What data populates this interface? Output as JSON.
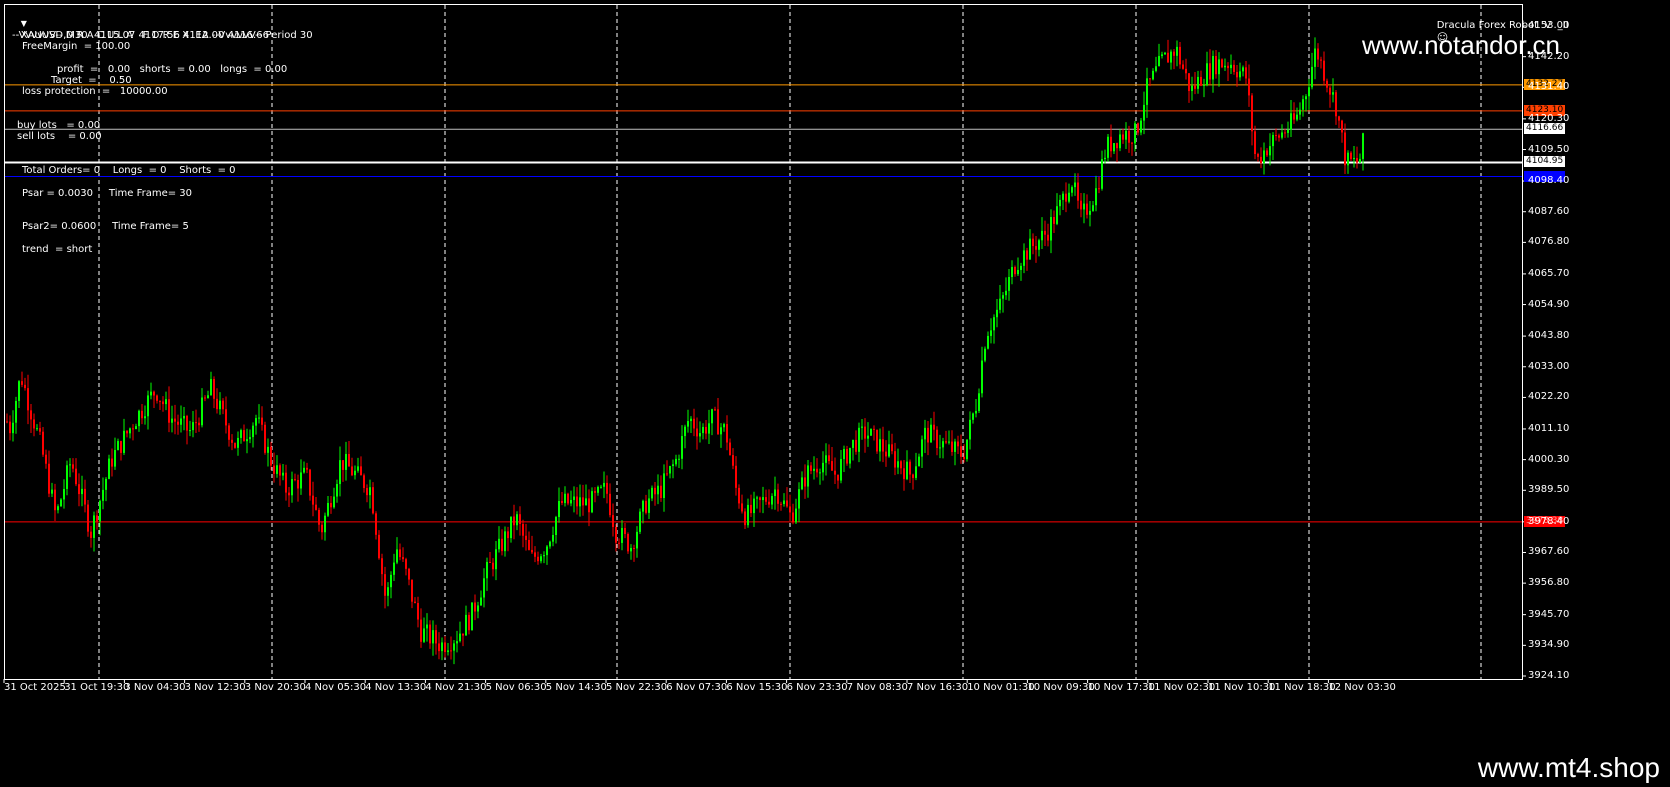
{
  "header": {
    "symbol_info": "XAUUSD,M30  4115.07 4117.56 4112.00 4116.66",
    "robot_label": "Dracula Forex Robot  V  _II"
  },
  "ea_panel": {
    "title": "--VvvvvV-- D R A C U L A   F O R E X  EA --VvvvvV-- Period 30",
    "free_margin": "FreeMargin  = 100.00",
    "profit_line": "profit  =   0.00   shorts  = 0.00   longs  = 0.00",
    "target_line": "Target  =    0.50",
    "loss_protection": "loss protection  =   10000.00",
    "buy_lots": "buy lots   = 0.00",
    "sell_lots": "sell lots    = 0.00",
    "total_orders": "Total Orders= 0    Longs  = 0    Shorts  = 0",
    "psar": "Psar = 0.0030     Time Frame= 30",
    "psar2": "Psar2= 0.0600     Time Frame= 5",
    "trend": "trend  = short"
  },
  "watermarks": {
    "top": "www.notandor.cn",
    "bottom": "www.mt4.shop"
  },
  "price_axis": {
    "ticks": [
      "4153.00",
      "4142.20",
      "4131.40",
      "4120.30",
      "4109.50",
      "4098.40",
      "4087.60",
      "4076.80",
      "4065.70",
      "4054.90",
      "4043.80",
      "4033.00",
      "4022.20",
      "4011.10",
      "4000.30",
      "3989.50",
      "3978.40",
      "3967.60",
      "3956.80",
      "3945.70",
      "3934.90",
      "3924.10"
    ],
    "tags": [
      {
        "label": "4132.27",
        "bg": "#ff9900",
        "fg": "#000000"
      },
      {
        "label": "4123.10",
        "bg": "#ff4000",
        "fg": "#000000"
      },
      {
        "label": "4116.66",
        "bg": "#ffffff",
        "fg": "#000000"
      },
      {
        "label": "4104.95",
        "bg": "#ffffff",
        "fg": "#000000"
      },
      {
        "label": "4100.00",
        "bg": "#0000ff",
        "fg": "#0000ff"
      },
      {
        "label": "3978.38",
        "bg": "#ff0000",
        "fg": "#ff9999"
      }
    ]
  },
  "time_axis": {
    "labels": [
      "31 Oct 2025",
      "31 Oct 19:30",
      "3 Nov 04:30",
      "3 Nov 12:30",
      "3 Nov 20:30",
      "4 Nov 05:30",
      "4 Nov 13:30",
      "4 Nov 21:30",
      "5 Nov 06:30",
      "5 Nov 14:30",
      "5 Nov 22:30",
      "6 Nov 07:30",
      "6 Nov 15:30",
      "6 Nov 23:30",
      "7 Nov 08:30",
      "7 Nov 16:30",
      "10 Nov 01:30",
      "10 Nov 09:30",
      "10 Nov 17:30",
      "11 Nov 02:30",
      "11 Nov 10:30",
      "11 Nov 18:30",
      "12 Nov 03:30"
    ]
  },
  "levels": {
    "orange": 4132.27,
    "red_orange": 4123.1,
    "gray": 4116.66,
    "white": 4104.95,
    "blue": 4100.0,
    "red": 3978.38
  },
  "colors": {
    "bull": "#00ff00",
    "bear": "#ff0000",
    "orange": "#ff9900",
    "red_orange": "#ff4000",
    "gray": "#c0c0c0",
    "white": "#ffffff",
    "blue": "#0000ff",
    "red": "#ff0000"
  },
  "chart_data": {
    "type": "candlestick",
    "symbol": "XAUUSD",
    "timeframe": "M30",
    "ylim": [
      3924.1,
      4153.0
    ],
    "anchors": [
      [
        0,
        4025
      ],
      [
        8,
        4010
      ],
      [
        20,
        4030
      ],
      [
        40,
        4005
      ],
      [
        55,
        3980
      ],
      [
        70,
        4000
      ],
      [
        90,
        3975
      ],
      [
        110,
        4000
      ],
      [
        135,
        4015
      ],
      [
        155,
        4025
      ],
      [
        170,
        4015
      ],
      [
        190,
        4010
      ],
      [
        210,
        4025
      ],
      [
        235,
        4005
      ],
      [
        255,
        4015
      ],
      [
        270,
        4000
      ],
      [
        285,
        3990
      ],
      [
        305,
        3995
      ],
      [
        320,
        3975
      ],
      [
        340,
        4000
      ],
      [
        355,
        3995
      ],
      [
        370,
        3990
      ],
      [
        385,
        3950
      ],
      [
        395,
        3970
      ],
      [
        405,
        3960
      ],
      [
        420,
        3940
      ],
      [
        440,
        3935
      ],
      [
        455,
        3938
      ],
      [
        470,
        3945
      ],
      [
        485,
        3960
      ],
      [
        500,
        3970
      ],
      [
        515,
        3980
      ],
      [
        530,
        3965
      ],
      [
        545,
        3970
      ],
      [
        560,
        3985
      ],
      [
        575,
        3985
      ],
      [
        590,
        3985
      ],
      [
        605,
        3990
      ],
      [
        615,
        3975
      ],
      [
        630,
        3970
      ],
      [
        645,
        3985
      ],
      [
        660,
        3990
      ],
      [
        675,
        4000
      ],
      [
        688,
        4015
      ],
      [
        700,
        4010
      ],
      [
        712,
        4015
      ],
      [
        725,
        4010
      ],
      [
        735,
        3990
      ],
      [
        745,
        3980
      ],
      [
        760,
        3985
      ],
      [
        775,
        3990
      ],
      [
        790,
        3980
      ],
      [
        805,
        3995
      ],
      [
        820,
        4000
      ],
      [
        835,
        3995
      ],
      [
        850,
        4005
      ],
      [
        865,
        4010
      ],
      [
        880,
        4005
      ],
      [
        895,
        4000
      ],
      [
        910,
        3995
      ],
      [
        925,
        4010
      ],
      [
        945,
        4005
      ],
      [
        962,
        4002
      ],
      [
        975,
        4020
      ],
      [
        985,
        4045
      ],
      [
        1000,
        4055
      ],
      [
        1015,
        4070
      ],
      [
        1030,
        4075
      ],
      [
        1045,
        4080
      ],
      [
        1060,
        4090
      ],
      [
        1070,
        4100
      ],
      [
        1080,
        4085
      ],
      [
        1095,
        4095
      ],
      [
        1105,
        4110
      ],
      [
        1120,
        4115
      ],
      [
        1135,
        4115
      ],
      [
        1145,
        4130
      ],
      [
        1160,
        4140
      ],
      [
        1175,
        4145
      ],
      [
        1190,
        4130
      ],
      [
        1200,
        4135
      ],
      [
        1215,
        4140
      ],
      [
        1230,
        4140
      ],
      [
        1245,
        4135
      ],
      [
        1255,
        4105
      ],
      [
        1265,
        4110
      ],
      [
        1280,
        4115
      ],
      [
        1295,
        4120
      ],
      [
        1305,
        4130
      ],
      [
        1315,
        4145
      ],
      [
        1325,
        4135
      ],
      [
        1335,
        4125
      ],
      [
        1345,
        4105
      ],
      [
        1358,
        4105
      ],
      [
        1365,
        4116
      ]
    ]
  }
}
